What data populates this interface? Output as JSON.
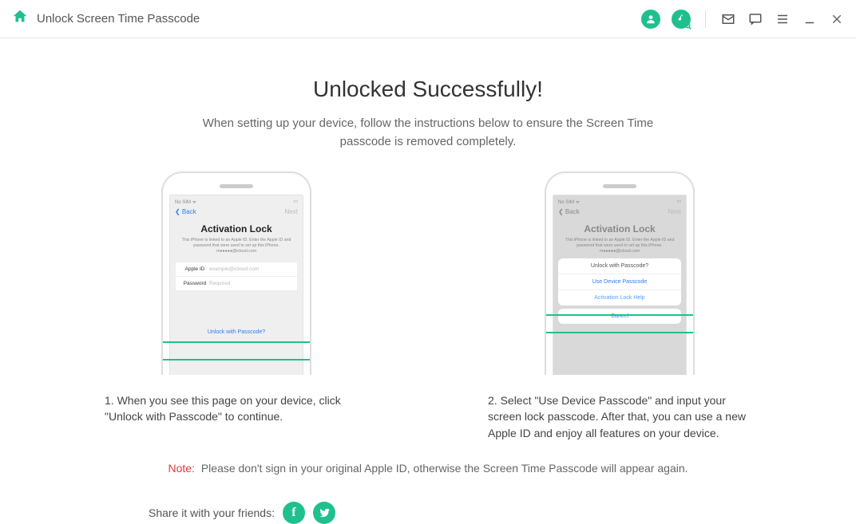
{
  "header": {
    "title": "Unlock Screen Time Passcode"
  },
  "main": {
    "title": "Unlocked Successfully!",
    "desc": "When setting up your device, follow the instructions below to ensure the Screen Time passcode is removed completely."
  },
  "phone1": {
    "status_left": "No SIM ᯤ",
    "status_right": "▭",
    "back": "❮ Back",
    "next": "Next",
    "act_title": "Activation Lock",
    "act_desc": "This iPhone is linked to an Apple ID. Enter the Apple ID and password that were used to set up this iPhone. m●●●●●@icloud.com",
    "field_id_label": "Apple ID",
    "field_id_placeholder": "example@icloud.com",
    "field_pw_label": "Password",
    "field_pw_placeholder": "Required",
    "link": "Unlock with Passcode?"
  },
  "phone2": {
    "status_left": "No SIM ᯤ",
    "status_right": "▭",
    "back": "❮ Back",
    "next": "Next",
    "act_title": "Activation Lock",
    "act_desc": "This iPhone is linked to an Apple ID. Enter the Apple ID and password that were used to set up this iPhone. m●●●●●@icloud.com",
    "popup_q": "Unlock with Passcode?",
    "popup_action": "Use Device Passcode",
    "popup_help": "Activation Lock Help",
    "popup_cancel": "Cancel"
  },
  "steps": {
    "s1": "1. When you see this page on your device, click \"Unlock with Passcode\" to continue.",
    "s2": "2. Select \"Use Device Passcode\" and input your screen lock passcode. After that, you can use a new Apple ID and enjoy all features on your device."
  },
  "note": {
    "label": "Note:",
    "text": "Please don't sign in your original Apple ID, otherwise the Screen Time Passcode will appear again."
  },
  "share": {
    "label": "Share it with your friends:",
    "fb": "f",
    "tw": "t"
  }
}
